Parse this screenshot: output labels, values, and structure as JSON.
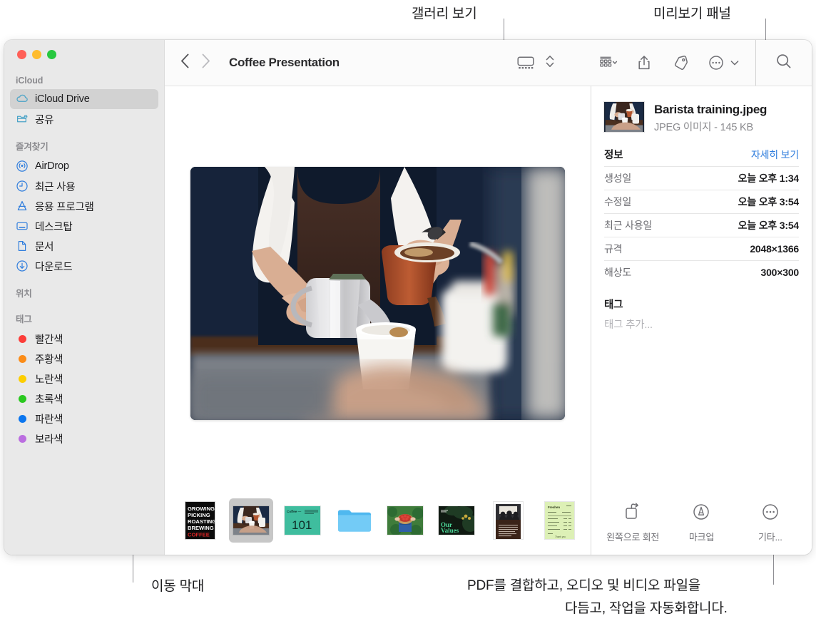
{
  "annotations": {
    "gallery_view": "갤러리 보기",
    "preview_panel": "미리보기 패널",
    "scroll_bar": "이동 막대",
    "bottom_note_line1": "PDF를 결합하고, 오디오 및 비디오 파일을",
    "bottom_note_line2": "다듬고, 작업을 자동화합니다."
  },
  "window": {
    "traffic_lights": [
      "close",
      "minimize",
      "zoom"
    ]
  },
  "toolbar": {
    "back_icon": "chevron-left-icon",
    "forward_icon": "chevron-right-icon",
    "title": "Coffee Presentation",
    "view_gallery_icon": "gallery-view-icon",
    "view_stepper_icon": "chevron-up-down-icon",
    "group_icon": "group-by-icon",
    "group_chevron_icon": "chevron-down-icon",
    "share_icon": "share-icon",
    "tag_icon": "tag-icon",
    "more_icon": "ellipsis-circle-icon",
    "more_chevron_icon": "chevron-down-icon",
    "search_icon": "search-icon"
  },
  "sidebar": {
    "sections": [
      {
        "header": "iCloud",
        "items": [
          {
            "label": "iCloud Drive",
            "icon": "cloud-icon",
            "selected": true
          },
          {
            "label": "공유",
            "icon": "shared-folder-icon",
            "selected": false
          }
        ]
      },
      {
        "header": "즐겨찾기",
        "items": [
          {
            "label": "AirDrop",
            "icon": "airdrop-icon",
            "selected": false
          },
          {
            "label": "최근 사용",
            "icon": "clock-icon",
            "selected": false
          },
          {
            "label": "응용 프로그램",
            "icon": "applications-icon",
            "selected": false
          },
          {
            "label": "데스크탑",
            "icon": "desktop-icon",
            "selected": false
          },
          {
            "label": "문서",
            "icon": "document-icon",
            "selected": false
          },
          {
            "label": "다운로드",
            "icon": "download-icon",
            "selected": false
          }
        ]
      },
      {
        "header": "위치",
        "items": []
      },
      {
        "header": "태그",
        "items": [
          {
            "label": "빨간색",
            "icon": "tag-dot",
            "color": "#fc3d39"
          },
          {
            "label": "주황색",
            "icon": "tag-dot",
            "color": "#fb8c18"
          },
          {
            "label": "노란색",
            "icon": "tag-dot",
            "color": "#fdce00"
          },
          {
            "label": "초록색",
            "icon": "tag-dot",
            "color": "#2ac81f"
          },
          {
            "label": "파란색",
            "icon": "tag-dot",
            "color": "#0b76ef"
          },
          {
            "label": "보라색",
            "icon": "tag-dot",
            "color": "#bb6ee0"
          }
        ]
      }
    ]
  },
  "gallery": {
    "hero_alt": "Barista pouring coffee into a paper cup",
    "thumbnails": [
      {
        "name": "growing-picking-roasting-brewing-coffee-poster",
        "selected": false
      },
      {
        "name": "barista-training-photo",
        "selected": true
      },
      {
        "name": "coffee-101-slide",
        "selected": false
      },
      {
        "name": "blue-folder",
        "selected": false
      },
      {
        "name": "cherry-harvest-photo",
        "selected": false
      },
      {
        "name": "our-values-slide",
        "selected": false
      },
      {
        "name": "meeting-photo-document",
        "selected": false
      },
      {
        "name": "green-invoice-document",
        "selected": false
      }
    ],
    "poster_lines": [
      "GROWING",
      "PICKING",
      "ROASTING",
      "BREWING",
      "COFFEE"
    ],
    "slide_101": {
      "label": "Coffee —",
      "number": "101"
    },
    "our_values": {
      "line1": "Our",
      "line2": "Values"
    }
  },
  "preview": {
    "file_name": "Barista training.jpeg",
    "file_subtitle": "JPEG 이미지 - 145 KB",
    "info_title": "정보",
    "info_link": "자세히 보기",
    "info_rows": [
      {
        "key": "생성일",
        "value": "오늘 오후 1:34"
      },
      {
        "key": "수정일",
        "value": "오늘 오후 3:54"
      },
      {
        "key": "최근 사용일",
        "value": "오늘 오후 3:54"
      },
      {
        "key": "규격",
        "value": "2048×1366"
      },
      {
        "key": "해상도",
        "value": "300×300"
      }
    ],
    "tags_title": "태그",
    "tags_placeholder": "태그 추가...",
    "actions": [
      {
        "label": "왼쪽으로 회전",
        "icon": "rotate-left-icon"
      },
      {
        "label": "마크업",
        "icon": "markup-icon"
      },
      {
        "label": "기타...",
        "icon": "ellipsis-circle-icon"
      }
    ]
  },
  "colors": {
    "accent_blue": "#2f7ddd",
    "sidebar_bg": "#e9e9e9",
    "selection_gray": "#d2d2d2",
    "toolbar_bg": "#fbfbfb"
  }
}
